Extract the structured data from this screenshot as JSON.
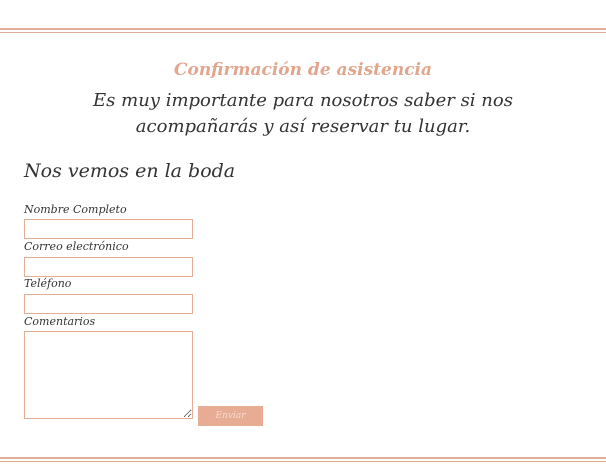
{
  "rsvp": {
    "title": "Confirmación de asistencia",
    "intro": "Es muy importante para nosotros saber si nos acompañarás y así reservar tu lugar."
  },
  "form": {
    "heading": "Nos vemos en la boda",
    "fields": {
      "name_label": "Nombre Completo",
      "email_label": "Correo electrónico",
      "phone_label": "Teléfono",
      "comments_label": "Comentarios"
    },
    "values": {
      "name": "",
      "email": "",
      "phone": "",
      "comments": ""
    },
    "submit_label": "Enviar"
  },
  "colors": {
    "accent": "#e2a68e",
    "button_bg": "#e8ab93",
    "text": "#333333"
  }
}
